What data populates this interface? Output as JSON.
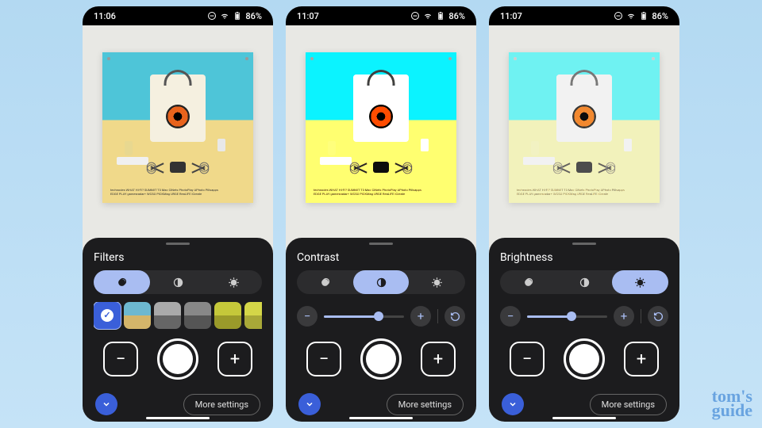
{
  "screens": [
    {
      "time": "11:06",
      "battery": "86%",
      "title": "Filters",
      "activeTab": 0,
      "mode": "filters"
    },
    {
      "time": "11:07",
      "battery": "86%",
      "title": "Contrast",
      "activeTab": 1,
      "mode": "slider",
      "sliderPct": 68
    },
    {
      "time": "11:07",
      "battery": "86%",
      "title": "Brightness",
      "activeTab": 2,
      "mode": "slider",
      "sliderPct": 55
    }
  ],
  "moreSettings": "More settings",
  "watermark": "tom's\nguide",
  "posterLine1": "technodes  WHAT HI-FI?  SUMMIT  T3  Mac  CiNets  PhotoPlay  APhoto  Pillsapps",
  "posterLine2": "EDGE  PLAY  gamesradar+  WCSO  PICKMag  URGE  ReaLIFE  iCreate"
}
